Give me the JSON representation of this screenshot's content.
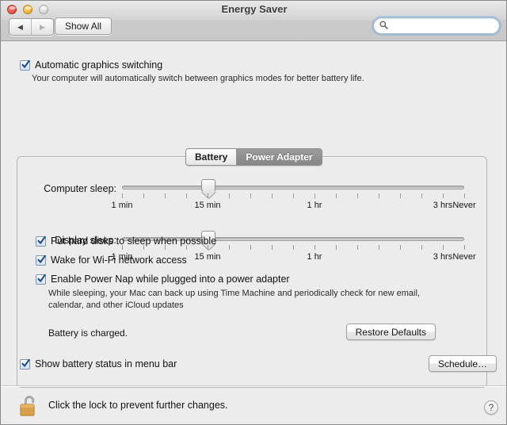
{
  "window": {
    "title": "Energy Saver",
    "traffic_lights": [
      "close",
      "minimize",
      "zoom"
    ]
  },
  "toolbar": {
    "back_glyph": "◀",
    "forward_glyph": "▶",
    "show_all_label": "Show All",
    "search_placeholder": "",
    "search_value": ""
  },
  "auto_switch": {
    "label": "Automatic graphics switching",
    "checked": true,
    "description": "Your computer will automatically switch between graphics modes for better battery life."
  },
  "tabs": [
    {
      "label": "Battery",
      "selected": false
    },
    {
      "label": "Power Adapter",
      "selected": true
    }
  ],
  "sliders": [
    {
      "label": "Computer sleep:",
      "value_index": 4,
      "tick_count": 17,
      "tick_labels": [
        {
          "index": 0,
          "text": "1 min"
        },
        {
          "index": 4,
          "text": "15 min"
        },
        {
          "index": 9,
          "text": "1 hr"
        },
        {
          "index": 15,
          "text": "3 hrs"
        },
        {
          "index": 16,
          "text": "Never"
        }
      ]
    },
    {
      "label": "Display sleep:",
      "value_index": 4,
      "tick_count": 17,
      "tick_labels": [
        {
          "index": 0,
          "text": "1 min"
        },
        {
          "index": 4,
          "text": "15 min"
        },
        {
          "index": 9,
          "text": "1 hr"
        },
        {
          "index": 15,
          "text": "3 hrs"
        },
        {
          "index": 16,
          "text": "Never"
        }
      ]
    }
  ],
  "options": [
    {
      "label": "Put hard disks to sleep when possible",
      "checked": true,
      "description": null
    },
    {
      "label": "Wake for Wi-Fi network access",
      "checked": true,
      "description": null
    },
    {
      "label": "Enable Power Nap while plugged into a power adapter",
      "checked": true,
      "description": "While sleeping, your Mac can back up using Time Machine and periodically check for new email, calendar, and other iCloud updates"
    }
  ],
  "status": {
    "battery_text": "Battery is charged.",
    "restore_defaults_label": "Restore Defaults"
  },
  "menu_bar_option": {
    "label": "Show battery status in menu bar",
    "checked": true
  },
  "schedule_button_label": "Schedule…",
  "footer": {
    "lock_text": "Click the lock to prevent further changes.",
    "lock_state": "unlocked",
    "help_glyph": "?"
  },
  "colors": {
    "window_bg": "#ececec",
    "titlebar_top": "#e9e9e9",
    "titlebar_bottom": "#c8c8c8",
    "checkbox_accent": "#3c73b4",
    "tab_selected_bg": "#8f8f8f",
    "lock_body": "#e0a64a"
  }
}
